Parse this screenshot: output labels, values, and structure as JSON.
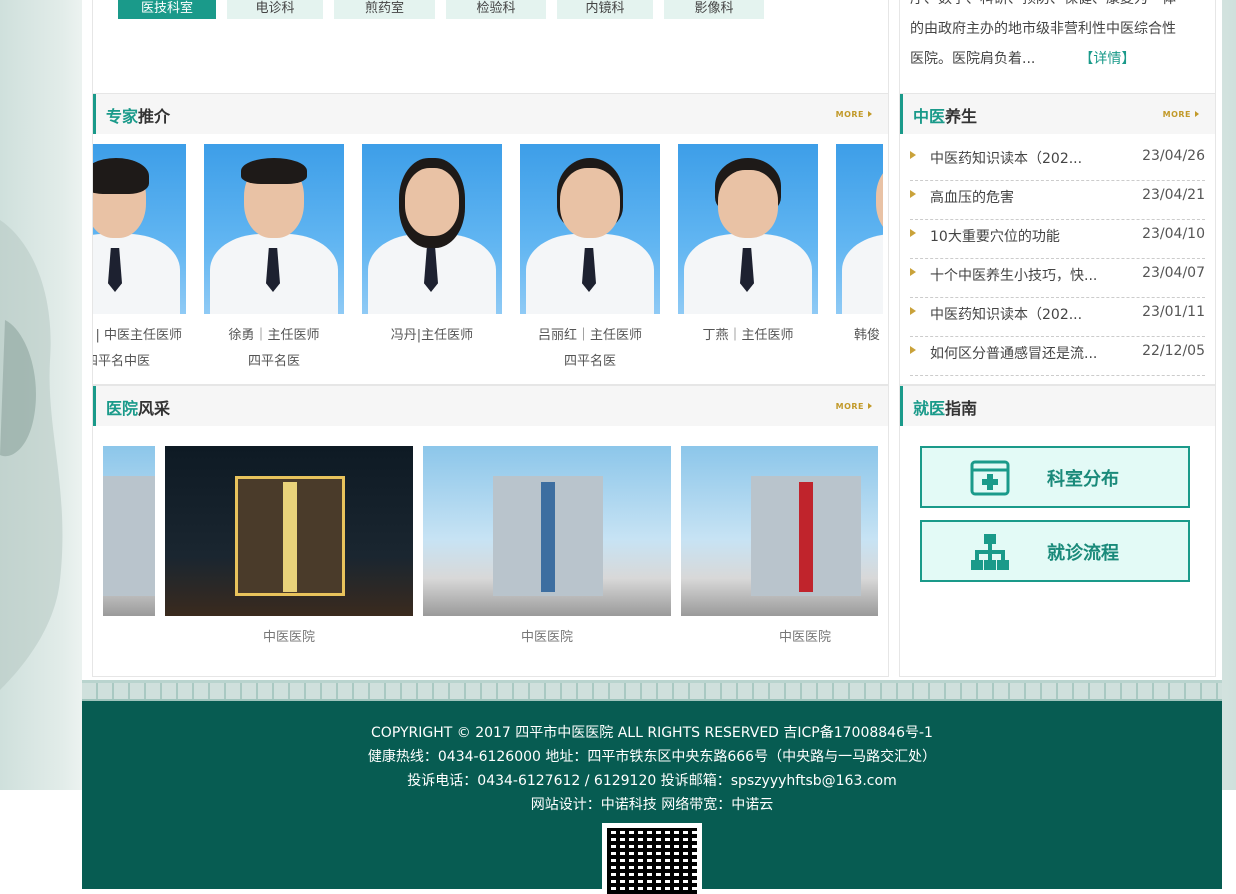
{
  "tabs": [
    {
      "label": "医技科室",
      "active": true
    },
    {
      "label": "电诊科"
    },
    {
      "label": "煎药室"
    },
    {
      "label": "检验科"
    },
    {
      "label": "内镜科"
    },
    {
      "label": "影像科"
    }
  ],
  "intro": {
    "line0": "厅、数字、科研、预防、保健、康复为一体",
    "line1": "的由政府主办的地市级非营利性中医综合性",
    "line2": "医院。医院肩负着...",
    "detail": "【详情】"
  },
  "experts": {
    "title_accent": "专家",
    "title_rest": "推介",
    "more": "MORE",
    "items": [
      {
        "name": "| 中医主任医师",
        "sub": "四平名中医"
      },
      {
        "name": "徐勇｜主任医师",
        "sub": "四平名医"
      },
      {
        "name": "冯丹|主任医师",
        "sub": ""
      },
      {
        "name": "吕丽红｜主任医师",
        "sub": "四平名医"
      },
      {
        "name": "丁燕｜主任医师",
        "sub": ""
      },
      {
        "name": "韩俊",
        "sub": ""
      }
    ]
  },
  "health": {
    "title_accent": "中医",
    "title_rest": "养生",
    "more": "MORE",
    "items": [
      {
        "title": "中医药知识读本（202...",
        "date": "23/04/26"
      },
      {
        "title": "高血压的危害",
        "date": "23/04/21"
      },
      {
        "title": "10大重要穴位的功能",
        "date": "23/04/10"
      },
      {
        "title": "十个中医养生小技巧，快...",
        "date": "23/04/07"
      },
      {
        "title": "中医药知识读本（202...",
        "date": "23/01/11"
      },
      {
        "title": "如何区分普通感冒还是流...",
        "date": "22/12/05"
      }
    ]
  },
  "style": {
    "title_accent": "医院",
    "title_rest": "风采",
    "more": "MORE",
    "items": [
      {
        "caption": "中医医院"
      },
      {
        "caption": "中医医院"
      },
      {
        "caption": "中医医院"
      }
    ]
  },
  "guide": {
    "title_accent": "就医",
    "title_rest": "指南",
    "buttons": [
      {
        "label": "科室分布",
        "icon": "plus-box-icon"
      },
      {
        "label": "就诊流程",
        "icon": "sitemap-icon"
      }
    ]
  },
  "footer": {
    "line1": "COPYRIGHT © 2017 四平市中医医院 ALL RIGHTS RESERVED 吉ICP备17008846号-1",
    "line2": "健康热线：0434-6126000   地址：四平市铁东区中央东路666号（中央路与一马路交汇处）",
    "line3": "投诉电话：0434-6127612 / 6129120   投诉邮箱：spszyyyhftsb@163.com",
    "line4": "网站设计：中诺科技   网络带宽：中诺云"
  },
  "colors": {
    "accent": "#1a9a8a",
    "footer_bg": "#075c52",
    "gold": "#c9a23a"
  }
}
